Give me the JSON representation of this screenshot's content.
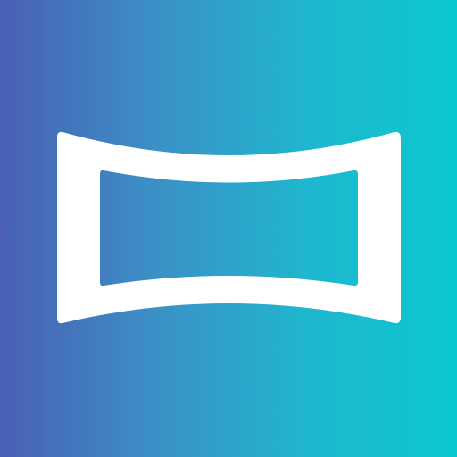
{
  "icon": {
    "name": "panorama-icon",
    "symbol_color": "#FFFFFF",
    "background_gradient": [
      "#4A5FB4",
      "#3C8FC6",
      "#1FB6CF",
      "#0BC8CF"
    ]
  }
}
